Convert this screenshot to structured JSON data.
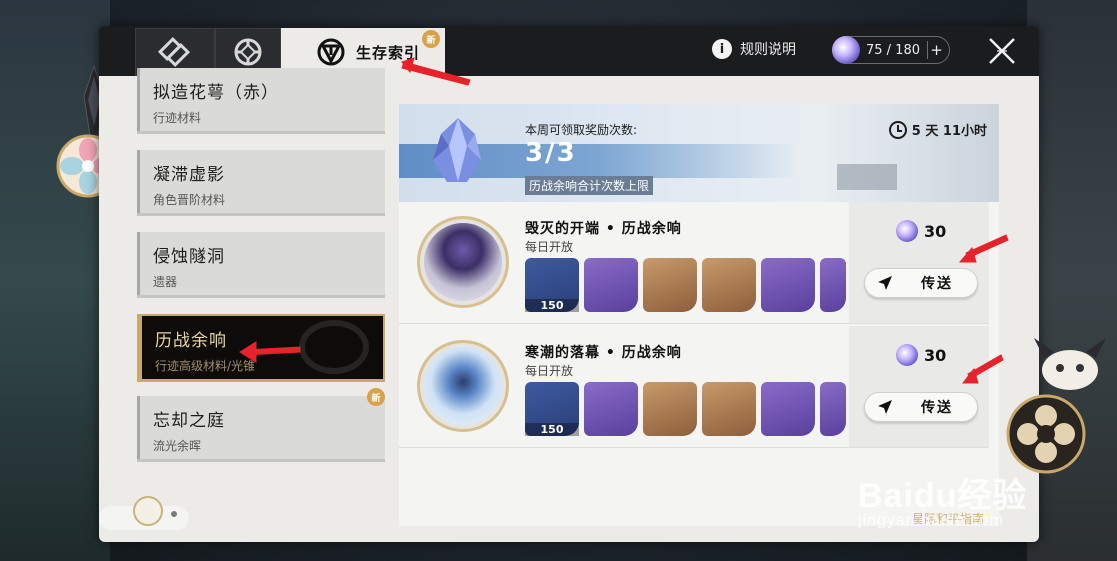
{
  "tabs": [
    {
      "icon": "shield-book-icon"
    },
    {
      "icon": "compass-icon"
    },
    {
      "icon": "survival-guide-icon",
      "label": "生存索引",
      "badge": "新"
    }
  ],
  "header": {
    "rules_label": "规则说明",
    "power_label": "75 / 180",
    "power_plus": "+"
  },
  "list": [
    {
      "title": "拟造花萼（赤）",
      "sub": "行迹材料"
    },
    {
      "title": "凝滞虚影",
      "sub": "角色晋阶材料"
    },
    {
      "title": "侵蚀隧洞",
      "sub": "遗器"
    },
    {
      "title": "历战余响",
      "sub": "行迹高级材料/光锥",
      "active": true
    },
    {
      "title": "忘却之庭",
      "sub": "流光余晖",
      "badge": "新"
    }
  ],
  "banner": {
    "label": "本周可领取奖励次数:",
    "count": "3/3",
    "note": "历战余响合计次数上限",
    "timer": "5  天 11小时"
  },
  "rows": [
    {
      "title": "毁灭的开端 • 历战余响",
      "sub": "每日开放",
      "cost": "30",
      "button": "传送",
      "first_item_count": "150"
    },
    {
      "title": "寒潮的落幕 • 历战余响",
      "sub": "每日开放",
      "cost": "30",
      "button": "传送",
      "first_item_count": "150"
    }
  ],
  "watermark": {
    "main": "Baidu经验",
    "sub": "jingyan.baidu.com",
    "under": "星际和平指南"
  }
}
